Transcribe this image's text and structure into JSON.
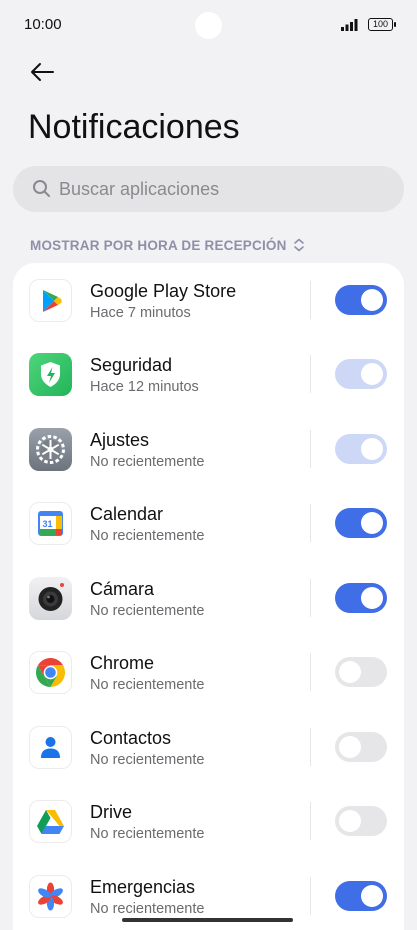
{
  "status_bar": {
    "time": "10:00",
    "battery": "100"
  },
  "header": {
    "title": "Notificaciones"
  },
  "search": {
    "placeholder": "Buscar aplicaciones"
  },
  "sort": {
    "label": "MOSTRAR POR HORA DE RECEPCIÓN"
  },
  "colors": {
    "accent": "#3f6ee6",
    "accent_disabled": "#cdd8f7",
    "toggle_off": "#e6e6e8"
  },
  "apps": [
    {
      "name": "Google Play Store",
      "sub": "Hace 7 minutos",
      "icon": "google-play-store-icon",
      "enabled": true,
      "disabled": false
    },
    {
      "name": "Seguridad",
      "sub": "Hace 12 minutos",
      "icon": "security-shield-icon",
      "enabled": true,
      "disabled": true
    },
    {
      "name": "Ajustes",
      "sub": "No recientemente",
      "icon": "settings-gear-icon",
      "enabled": true,
      "disabled": true
    },
    {
      "name": "Calendar",
      "sub": "No recientemente",
      "icon": "calendar-icon",
      "enabled": true,
      "disabled": false
    },
    {
      "name": "Cámara",
      "sub": "No recientemente",
      "icon": "camera-icon",
      "enabled": true,
      "disabled": false
    },
    {
      "name": "Chrome",
      "sub": "No recientemente",
      "icon": "chrome-icon",
      "enabled": false,
      "disabled": false
    },
    {
      "name": "Contactos",
      "sub": "No recientemente",
      "icon": "contacts-icon",
      "enabled": false,
      "disabled": false
    },
    {
      "name": "Drive",
      "sub": "No recientemente",
      "icon": "drive-icon",
      "enabled": false,
      "disabled": false
    },
    {
      "name": "Emergencias",
      "sub": "No recientemente",
      "icon": "emergency-icon",
      "enabled": true,
      "disabled": false
    }
  ],
  "calendar_day": "31"
}
